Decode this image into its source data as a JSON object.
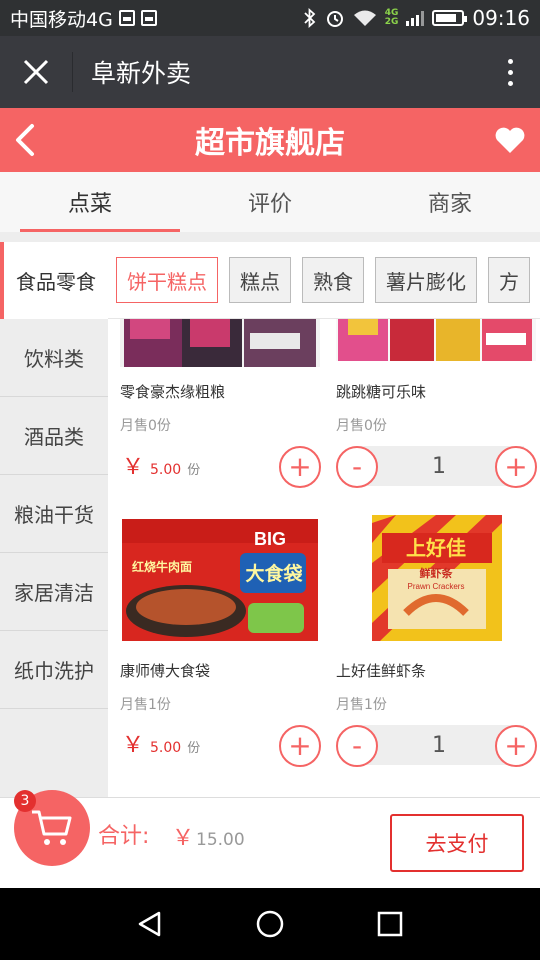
{
  "status_bar": {
    "carrier": "中国移动4G",
    "net_top": "4G",
    "net_bottom": "2G",
    "time": "09:16"
  },
  "wx_header": {
    "title": "阜新外卖"
  },
  "store": {
    "title": "超市旗舰店"
  },
  "tabs": [
    {
      "label": "点菜",
      "active": true
    },
    {
      "label": "评价",
      "active": false
    },
    {
      "label": "商家",
      "active": false
    }
  ],
  "categories": {
    "active": "食品零食",
    "sub": [
      "饼干糕点",
      "糕点",
      "熟食",
      "薯片膨化",
      "方"
    ],
    "active_sub_index": 0
  },
  "sidebar": [
    "饮料类",
    "酒品类",
    "粮油干货",
    "家居清洁",
    "纸巾洗护"
  ],
  "products": [
    {
      "name": "零食豪杰缘粗粮",
      "sold": "月售0份",
      "currency": "￥",
      "price": "5.00",
      "unit": "份",
      "plus": "+"
    },
    {
      "name": "跳跳糖可乐味",
      "sold": "月售0份",
      "minus": "-",
      "qty": "1",
      "plus": "+"
    },
    {
      "name": "康师傅大食袋",
      "sold": "月售1份",
      "currency": "￥",
      "price": "5.00",
      "unit": "份",
      "plus": "+",
      "image_text": {
        "big": "BIG",
        "title": "大食袋",
        "flavor": "红烧牛肉面"
      }
    },
    {
      "name": "上好佳鲜虾条",
      "sold": "月售1份",
      "minus": "-",
      "qty": "1",
      "plus": "+",
      "image_text": {
        "brand": "上好佳",
        "sub": "鲜虾条",
        "en": "Prawn Crackers"
      }
    }
  ],
  "cart": {
    "badge": "3",
    "total_label": "合计:",
    "currency": "￥",
    "total": "15.00",
    "pay_label": "去支付"
  },
  "colors": {
    "accent": "#f56464",
    "price": "#e3302f",
    "status_bar": "#2f3133",
    "wx_header": "#393a3f"
  }
}
